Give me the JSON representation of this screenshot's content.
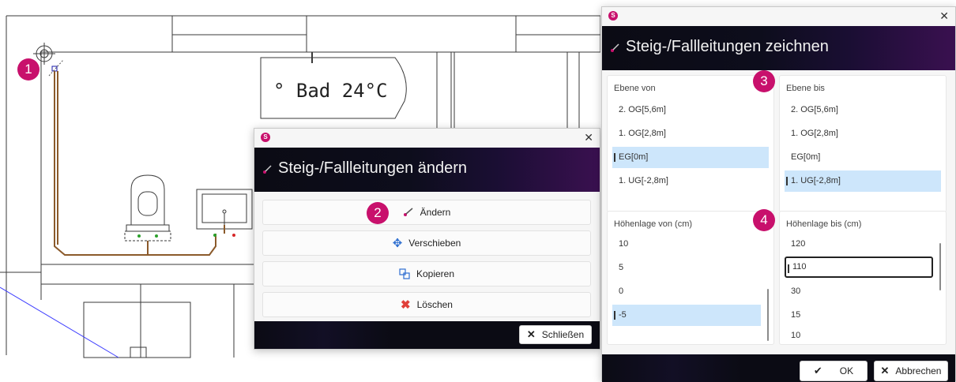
{
  "floorplan": {
    "room_label": "° Bad 24°C",
    "badges": [
      "1",
      "2",
      "3",
      "4"
    ]
  },
  "dialog_change": {
    "title": "Steig-/Fallleitungen ändern",
    "buttons": [
      "Ändern",
      "Verschieben",
      "Kopieren",
      "Löschen"
    ],
    "close_label": "Schließen"
  },
  "dialog_draw": {
    "title": "Steig-/Fallleitungen zeichnen",
    "level_from": {
      "label": "Ebene von",
      "items": [
        "2. OG[5,6m]",
        "1. OG[2,8m]",
        "EG[0m]",
        "1. UG[-2,8m]"
      ],
      "selected": "EG[0m]"
    },
    "level_to": {
      "label": "Ebene bis",
      "items": [
        "2. OG[5,6m]",
        "1. OG[2,8m]",
        "EG[0m]",
        "1. UG[-2,8m]"
      ],
      "selected": "1. UG[-2,8m]"
    },
    "height_from": {
      "label": "Höhenlage von (cm)",
      "items": [
        "10",
        "5",
        "0",
        "-5"
      ],
      "selected": "-5"
    },
    "height_to": {
      "label": "Höhenlage bis (cm)",
      "items": [
        "120",
        "110",
        "30",
        "15",
        "10"
      ],
      "selected": "110"
    },
    "ok_label": "OK",
    "cancel_label": "Abbrechen"
  },
  "colors": {
    "accent": "#c8106c",
    "selection": "#cde6fb",
    "pipe": "#8b5a2b"
  }
}
